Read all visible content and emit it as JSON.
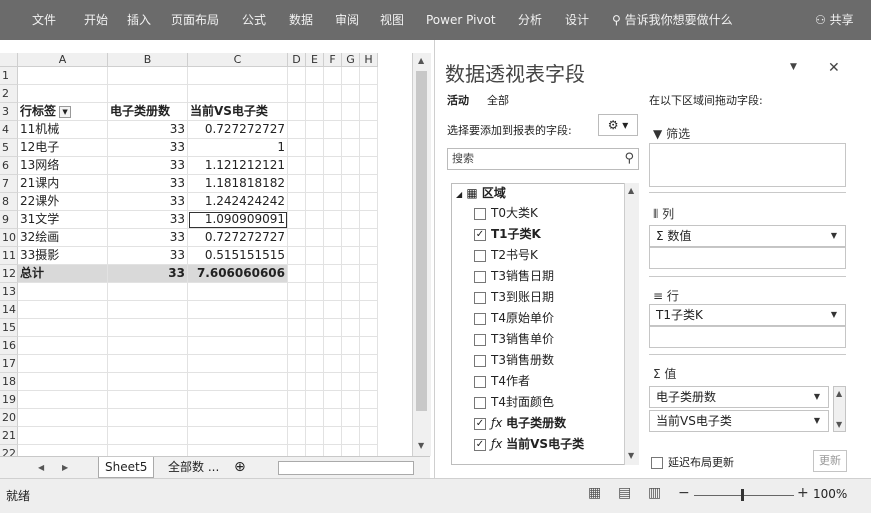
{
  "ribbon": {
    "tabs": [
      "文件",
      "开始",
      "插入",
      "页面布局",
      "公式",
      "数据",
      "审阅",
      "视图",
      "Power Pivot",
      "分析",
      "设计"
    ],
    "tell_me": "告诉我你想要做什么",
    "share": "共享"
  },
  "sheet": {
    "columns": [
      "A",
      "B",
      "C",
      "D",
      "E",
      "F",
      "G",
      "H"
    ],
    "rows": [
      "1",
      "2",
      "3",
      "4",
      "5",
      "6",
      "7",
      "8",
      "9",
      "10",
      "11",
      "12",
      "13",
      "14",
      "15",
      "16",
      "17",
      "18",
      "19",
      "20",
      "21",
      "22"
    ],
    "pivot_header": [
      "行标签",
      "电子类册数",
      "当前VS电子类"
    ],
    "pivot_rows": [
      {
        "label": "11机械",
        "count": "33",
        "ratio": "0.727272727"
      },
      {
        "label": "12电子",
        "count": "33",
        "ratio": "1"
      },
      {
        "label": "13网络",
        "count": "33",
        "ratio": "1.121212121"
      },
      {
        "label": "21课内",
        "count": "33",
        "ratio": "1.181818182"
      },
      {
        "label": "22课外",
        "count": "33",
        "ratio": "1.242424242"
      },
      {
        "label": "31文学",
        "count": "33",
        "ratio": "1.090909091"
      },
      {
        "label": "32绘画",
        "count": "33",
        "ratio": "0.727272727"
      },
      {
        "label": "33摄影",
        "count": "33",
        "ratio": "0.515151515"
      }
    ],
    "total": {
      "label": "总计",
      "count": "33",
      "ratio": "7.606060606"
    }
  },
  "tabs_bar": {
    "active_sheet": "Sheet5",
    "other_sheet": "全部数 ...",
    "add": "⊕"
  },
  "status": {
    "ready": "就绪",
    "zoom": "100%"
  },
  "pane": {
    "title": "数据透视表字段",
    "tab_active": "活动",
    "tab_all": "全部",
    "choose_label": "选择要添加到报表的字段:",
    "search_placeholder": "搜索",
    "drag_label": "在以下区域间拖动字段:",
    "table_name": "区域",
    "fields": [
      {
        "name": "T0大类K",
        "checked": false,
        "bold": false,
        "calc": false
      },
      {
        "name": "T1子类K",
        "checked": true,
        "bold": true,
        "calc": false
      },
      {
        "name": "T2书号K",
        "checked": false,
        "bold": false,
        "calc": false
      },
      {
        "name": "T3销售日期",
        "checked": false,
        "bold": false,
        "calc": false
      },
      {
        "name": "T3到账日期",
        "checked": false,
        "bold": false,
        "calc": false
      },
      {
        "name": "T4原始单价",
        "checked": false,
        "bold": false,
        "calc": false
      },
      {
        "name": "T3销售单价",
        "checked": false,
        "bold": false,
        "calc": false
      },
      {
        "name": "T3销售册数",
        "checked": false,
        "bold": false,
        "calc": false
      },
      {
        "name": "T4作者",
        "checked": false,
        "bold": false,
        "calc": false
      },
      {
        "name": "T4封面颜色",
        "checked": false,
        "bold": false,
        "calc": false
      },
      {
        "name": "电子类册数",
        "checked": true,
        "bold": true,
        "calc": true
      },
      {
        "name": "当前VS电子类",
        "checked": true,
        "bold": true,
        "calc": true
      }
    ],
    "filters_label": "筛选",
    "columns_label": "列",
    "columns_item": "Σ 数值",
    "rows_label": "行",
    "rows_item": "T1子类K",
    "values_label": "Σ 值",
    "values_items": [
      "电子类册数",
      "当前VS电子类"
    ],
    "defer_label": "延迟布局更新",
    "update_button": "更新"
  },
  "colors": {
    "ribbon": "#6b6b6b",
    "total_row": "#d9d9d9"
  }
}
